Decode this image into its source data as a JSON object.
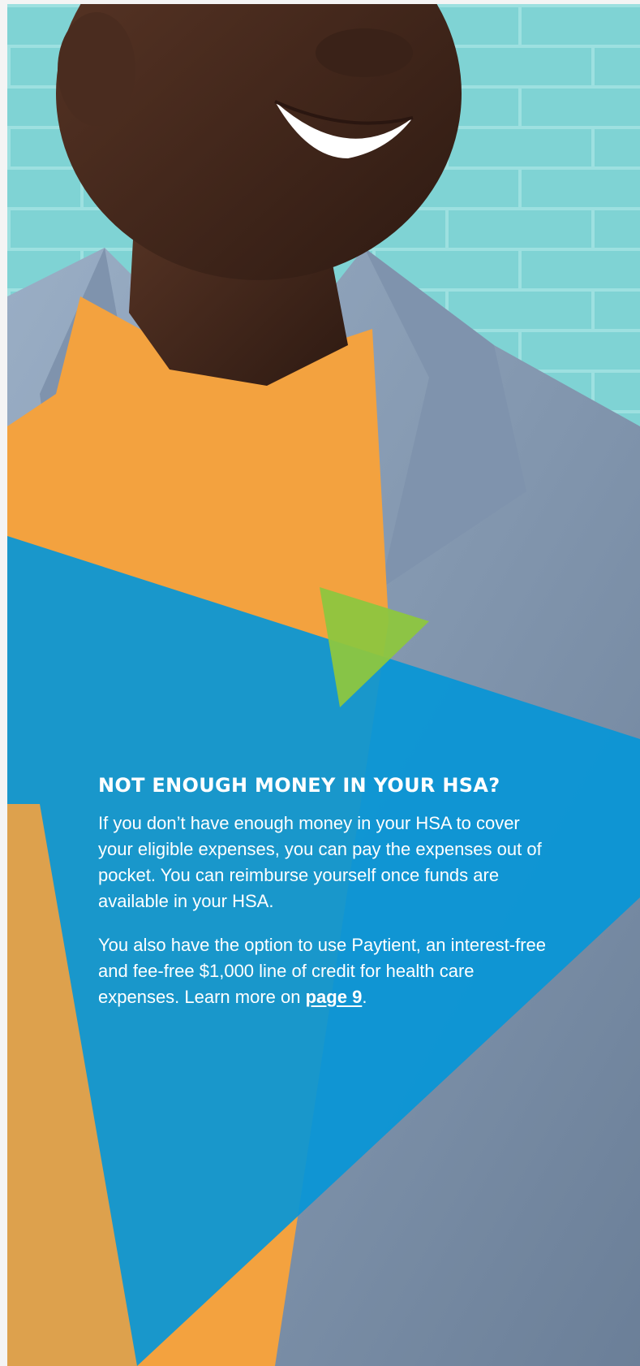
{
  "article": {
    "heading": "NOT ENOUGH MONEY IN YOUR HSA?",
    "paragraph1": "If you don’t have enough money in your HSA to cover your eligible expenses, you can pay the expenses out of pocket. You can reimburse yourself once funds are available in your HSA.",
    "paragraph2_prefix": "You also have the option to use Paytient, an interest-free and fee-free $1,000 line of credit for health care expenses. Learn more on ",
    "paragraph2_link": "page 9",
    "paragraph2_suffix": "."
  },
  "colors": {
    "page_background": "#f4f4f4",
    "wall_teal": "#7fd3d4",
    "brand_blue": "#0796d6",
    "accent_green": "#8dc63f",
    "shirt_orange": "#f3a23f",
    "denim": "#8ba0b8"
  },
  "image": {
    "subject": "smiling man in orange t-shirt and denim jacket against teal brick wall"
  }
}
